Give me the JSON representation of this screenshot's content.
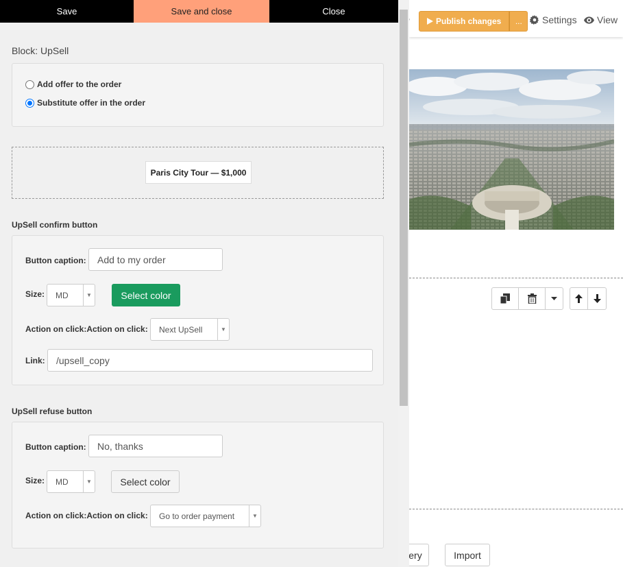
{
  "topbar": {
    "partial_text": "y",
    "publish_label": "Publish changes",
    "publish_more_label": "...",
    "settings_label": "Settings",
    "view_label": "View",
    "accent_color": "#f0ad4e"
  },
  "background_buttons": {
    "gallery_partial": "ery",
    "import_label": "Import"
  },
  "panel": {
    "actions": {
      "save": "Save",
      "save_close": "Save and close",
      "close": "Close"
    },
    "block_title": "Block: UpSell",
    "offer_mode": {
      "options": [
        {
          "label": "Add offer to the order",
          "checked": false
        },
        {
          "label": "Substitute offer in the order",
          "checked": true
        }
      ]
    },
    "offer_chip": "Paris City Tour — $1,000",
    "confirm": {
      "section_title": "UpSell confirm button",
      "caption_label": "Button caption:",
      "caption_value": "Add to my order",
      "size_label": "Size:",
      "size_value": "MD",
      "color_button": "Select color",
      "color_value": "#1a9b5e",
      "action_label": "Action on click:Action on click:",
      "action_value": "Next UpSell",
      "link_label": "Link:",
      "link_value": "/upsell_copy"
    },
    "refuse": {
      "section_title": "UpSell refuse button",
      "caption_label": "Button caption:",
      "caption_value": "No, thanks",
      "size_label": "Size:",
      "size_value": "MD",
      "color_button": "Select color",
      "action_label": "Action on click:Action on click:",
      "action_value": "Go to order payment"
    }
  }
}
